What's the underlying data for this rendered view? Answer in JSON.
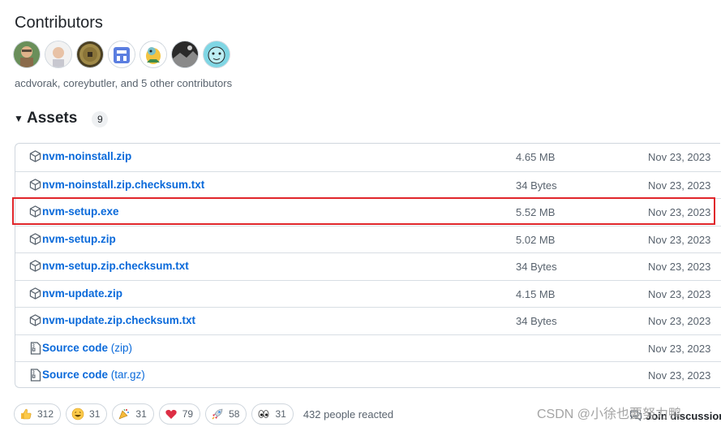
{
  "contributors": {
    "title": "Contributors",
    "avatars": [
      "acdvorak",
      "coreybutler",
      "contributor-3",
      "contributor-4",
      "contributor-5",
      "contributor-6",
      "contributor-7"
    ],
    "summary": "acdvorak, coreybutler, and 5 other contributors"
  },
  "assets": {
    "title": "Assets",
    "count": "9",
    "items": [
      {
        "name": "nvm-noinstall.zip",
        "size": "4.65 MB",
        "date": "Nov 23, 2023",
        "icon": "package-icon"
      },
      {
        "name": "nvm-noinstall.zip.checksum.txt",
        "size": "34 Bytes",
        "date": "Nov 23, 2023",
        "icon": "package-icon"
      },
      {
        "name": "nvm-setup.exe",
        "size": "5.52 MB",
        "date": "Nov 23, 2023",
        "icon": "package-icon"
      },
      {
        "name": "nvm-setup.zip",
        "size": "5.02 MB",
        "date": "Nov 23, 2023",
        "icon": "package-icon"
      },
      {
        "name": "nvm-setup.zip.checksum.txt",
        "size": "34 Bytes",
        "date": "Nov 23, 2023",
        "icon": "package-icon"
      },
      {
        "name": "nvm-update.zip",
        "size": "4.15 MB",
        "date": "Nov 23, 2023",
        "icon": "package-icon"
      },
      {
        "name": "nvm-update.zip.checksum.txt",
        "size": "34 Bytes",
        "date": "Nov 23, 2023",
        "icon": "package-icon"
      },
      {
        "name": "Source code",
        "suffix": "(zip)",
        "size": "",
        "date": "Nov 23, 2023",
        "icon": "file-zip-icon"
      },
      {
        "name": "Source code",
        "suffix": "(tar.gz)",
        "size": "",
        "date": "Nov 23, 2023",
        "icon": "file-zip-icon"
      }
    ],
    "highlighted_index": 2
  },
  "reactions": {
    "items": [
      {
        "emoji": "thumbs-up-icon",
        "count": "312"
      },
      {
        "emoji": "laugh-icon",
        "count": "31"
      },
      {
        "emoji": "hooray-icon",
        "count": "31"
      },
      {
        "emoji": "heart-icon",
        "count": "79"
      },
      {
        "emoji": "rocket-icon",
        "count": "58"
      },
      {
        "emoji": "eyes-icon",
        "count": "31"
      }
    ],
    "summary": "432 people reacted"
  },
  "discussion": {
    "label": "Join discussion"
  },
  "watermark": "CSDN @小徐也要努力鸭",
  "colors": {
    "link": "#0969da",
    "highlight_border": "#e0262b",
    "muted": "#59636e"
  }
}
